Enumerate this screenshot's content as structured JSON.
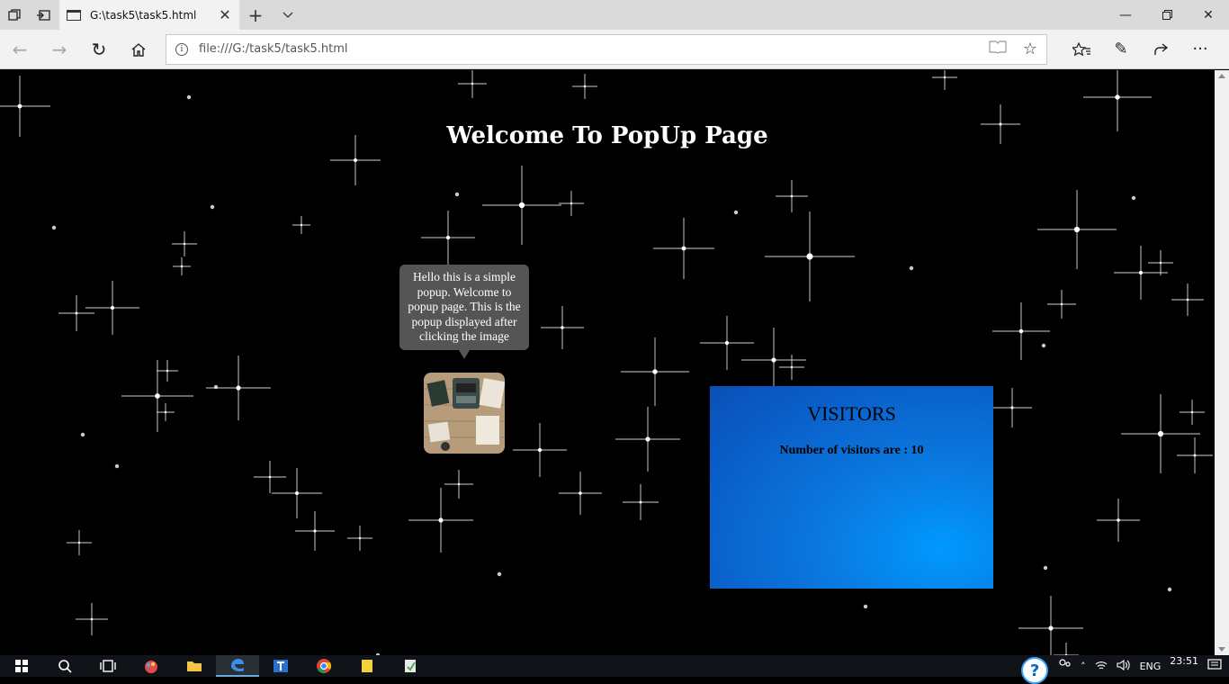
{
  "browser": {
    "tab_title": "G:\\task5\\task5.html",
    "url": "file:///G:/task5/task5.html"
  },
  "page": {
    "heading": "Welcome To PopUp Page",
    "popup_text": "Hello this is a simple popup. Welcome to popup page. This is the popup displayed after clicking the image",
    "visitors_title": "VISITORS",
    "visitors_count_text": "Number of visitors are : 10"
  },
  "taskbar": {
    "language": "ENG",
    "time": "23:51"
  },
  "icons": [
    "tab-view-icon",
    "set-aside-icon",
    "page-icon",
    "close-icon",
    "new-tab-icon",
    "tab-list-icon",
    "minimize-icon",
    "restore-icon",
    "window-close-icon",
    "back-icon",
    "forward-icon",
    "refresh-icon",
    "home-icon",
    "info-icon",
    "reading-view-icon",
    "favorite-star-icon",
    "favorites-icon",
    "notes-icon",
    "share-icon",
    "more-icon",
    "windows-start-icon",
    "search-icon",
    "task-view-icon",
    "edge-icon",
    "folder-icon",
    "chrome-icon",
    "help-icon",
    "network-icon",
    "volume-icon",
    "notification-icon"
  ]
}
